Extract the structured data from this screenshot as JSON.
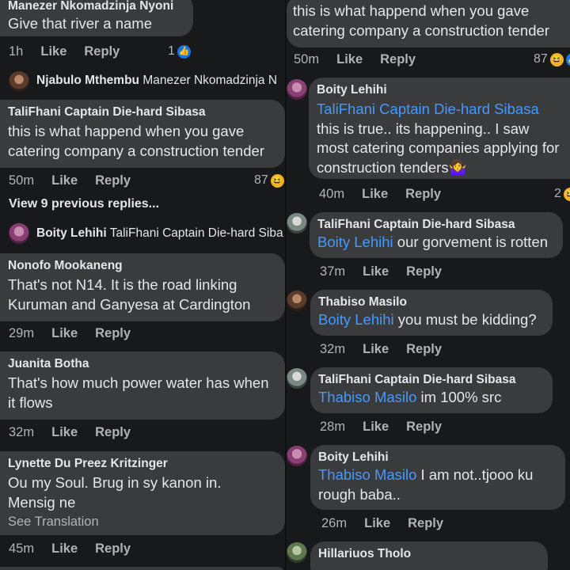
{
  "left": {
    "c1": {
      "author": "Manezer Nkomadzinja Nyoni",
      "text": "Give that river a name",
      "time": "1h",
      "like": "Like",
      "reply": "Reply",
      "reacts": "1"
    },
    "reply1": {
      "author": "Njabulo Mthembu",
      "mention": "Manezer Nkomadzinja N"
    },
    "c2": {
      "author": "TaliFhani Captain Die-hard Sibasa",
      "text": "this is what happend when you gave catering company a construction tender",
      "time": "50m",
      "like": "Like",
      "reply": "Reply",
      "reacts": "87"
    },
    "view_prev": "View 9 previous replies...",
    "reply2": {
      "author": "Boity Lehihi",
      "mention": "TaliFhani Captain Die-hard Siba"
    },
    "c3": {
      "author": "Nonofo Mookaneng",
      "text": "That's not N14. It is the road linking Kuruman and Ganyesa at Cardington",
      "time": "29m",
      "like": "Like",
      "reply": "Reply"
    },
    "c4": {
      "author": "Juanita Botha",
      "text": "That's how much power water has when it flows",
      "time": "32m",
      "like": "Like",
      "reply": "Reply"
    },
    "c5": {
      "author": "Lynette Du Preez Kritzinger",
      "text": "Ou my Soul. Brug in sy kanon in.  Mensig ne",
      "see_translation": "See Translation",
      "time": "45m",
      "like": "Like",
      "reply": "Reply"
    }
  },
  "right": {
    "c1": {
      "text": "this is what happend when you gave catering company a construction tender",
      "time": "50m",
      "like": "Like",
      "reply": "Reply",
      "reacts": "87"
    },
    "c2": {
      "author": "Boity Lehihi",
      "mention": "TaliFhani Captain Die-hard Sibasa",
      "text": "this is true.. its happening.. I saw most catering companies applying for construction tenders🤷‍♀️",
      "time": "40m",
      "like": "Like",
      "reply": "Reply",
      "reacts": "2"
    },
    "c3": {
      "author": "TaliFhani Captain Die-hard Sibasa",
      "mention": "Boity Lehihi",
      "text": " our gorvement is rotten",
      "time": "37m",
      "like": "Like",
      "reply": "Reply"
    },
    "c4": {
      "author": "Thabiso Masilo",
      "mention": "Boity Lehihi",
      "text": " you must be kidding?",
      "time": "32m",
      "like": "Like",
      "reply": "Reply"
    },
    "c5": {
      "author": "TaliFhani Captain Die-hard Sibasa",
      "mention": "Thabiso Masilo",
      "text": " im 100% src",
      "time": "28m",
      "like": "Like",
      "reply": "Reply"
    },
    "c6": {
      "author": "Boity Lehihi",
      "mention": "Thabiso Masilo",
      "text": " I am not..tjooo ku rough baba..",
      "time": "26m",
      "like": "Like",
      "reply": "Reply"
    },
    "c7": {
      "author": "Hillariuos Tholo"
    }
  }
}
